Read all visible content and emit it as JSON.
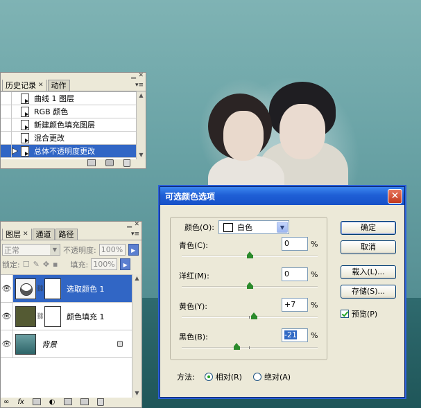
{
  "history_panel": {
    "tabs": [
      "历史记录",
      "动作"
    ],
    "items": [
      {
        "label": "曲线 1 图层",
        "selected": false
      },
      {
        "label": "RGB 颜色",
        "selected": false
      },
      {
        "label": "新建颜色填充图层",
        "selected": false
      },
      {
        "label": "混合更改",
        "selected": false
      },
      {
        "label": "总体不透明度更改",
        "selected": true
      }
    ]
  },
  "layers_panel": {
    "tabs": [
      "图层",
      "通道",
      "路径"
    ],
    "blend_mode": "正常",
    "opacity_label": "不透明度:",
    "opacity_value": "100%",
    "lock_label": "锁定:",
    "fill_label": "填充:",
    "fill_value": "100%",
    "layers": [
      {
        "name": "选取颜色 1",
        "type": "adjustment",
        "selected": true
      },
      {
        "name": "颜色填充 1",
        "type": "fill",
        "selected": false
      },
      {
        "name": "背景",
        "type": "background",
        "selected": false
      }
    ]
  },
  "dialog": {
    "title": "可选颜色选项",
    "colors_label": "颜色(O):",
    "colors_value": "白色",
    "sliders": [
      {
        "label": "青色(C):",
        "value": "0",
        "level": 0
      },
      {
        "label": "洋红(M):",
        "value": "0",
        "level": 0
      },
      {
        "label": "黄色(Y):",
        "value": "+7",
        "level": 7
      },
      {
        "label": "黑色(B):",
        "value": "-21",
        "level": -21
      }
    ],
    "percent_sign": "%",
    "method_label": "方法:",
    "method_relative": "相对(R)",
    "method_absolute": "绝对(A)",
    "method_selected": "relative",
    "buttons": {
      "ok": "确定",
      "cancel": "取消",
      "load": "载入(L)...",
      "save": "存储(S)..."
    },
    "preview_label": "预览(P)",
    "preview_checked": true
  },
  "colors": {
    "selection_blue": "#3166c5",
    "titlebar_blue": "#1f5fd6",
    "panel_gray": "#ece9d8",
    "slider_green": "#2b8a2b"
  }
}
